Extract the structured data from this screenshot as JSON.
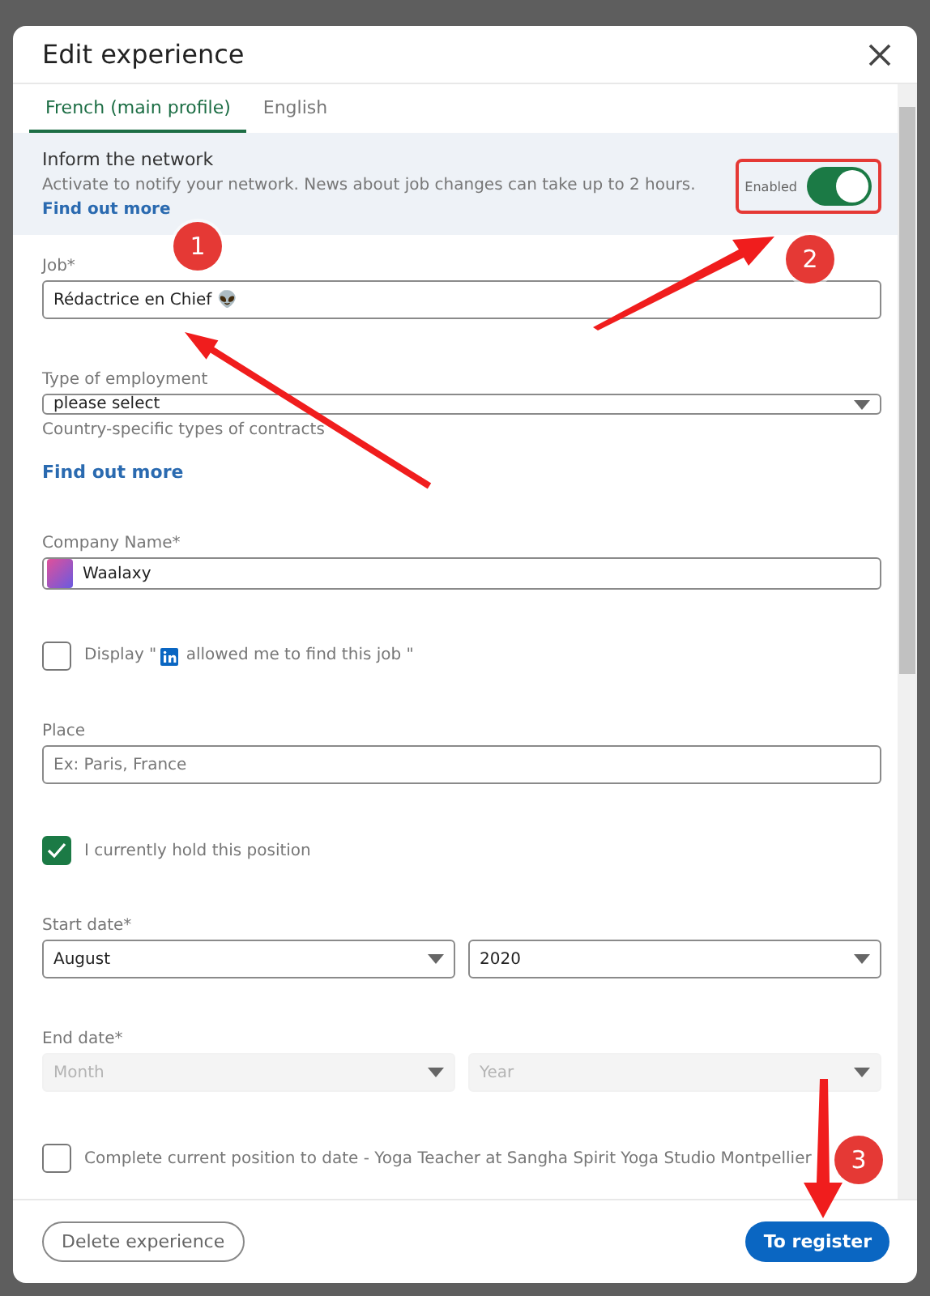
{
  "dialog": {
    "title": "Edit experience"
  },
  "tabs": [
    {
      "label": "French (main profile)",
      "selected": true
    },
    {
      "label": "English",
      "selected": false
    }
  ],
  "notify": {
    "title": "Inform the network",
    "text": "Activate to notify your network. News about job changes can take up to 2 hours.",
    "link": "Find out more",
    "toggle_label": "Enabled",
    "on": true
  },
  "form": [
    {
      "kind": "text",
      "label": "Job*",
      "value": "Rédactrice en Chief 👽"
    },
    {
      "kind": "select",
      "label": "Type of employment",
      "value": "please select",
      "hint": "Country-specific types of contracts",
      "link": "Find out more"
    },
    {
      "kind": "company",
      "label": "Company Name*",
      "value": "Waalaxy"
    },
    {
      "kind": "checkbox",
      "label": "Display \"",
      "label_after": " allowed me to find this job \"",
      "checked": false
    },
    {
      "kind": "text",
      "label": "Place",
      "placeholder": "Ex: Paris, France"
    },
    {
      "kind": "checkbox",
      "label": "I currently hold this position",
      "checked": true
    },
    {
      "kind": "date",
      "label": "Start date*",
      "month": "August",
      "year": "2020",
      "disabled": false
    },
    {
      "kind": "date",
      "label": "End date*",
      "month": "Month",
      "year": "Year",
      "disabled": true
    },
    {
      "kind": "checkbox",
      "label": "Complete current position to date - Yoga Teacher at Sangha Spirit Yoga Studio Montpellier",
      "checked": false
    }
  ],
  "footer": {
    "delete": "Delete experience",
    "save": "To register"
  },
  "annotations": [
    {
      "number": "1"
    },
    {
      "number": "2"
    },
    {
      "number": "3"
    }
  ]
}
